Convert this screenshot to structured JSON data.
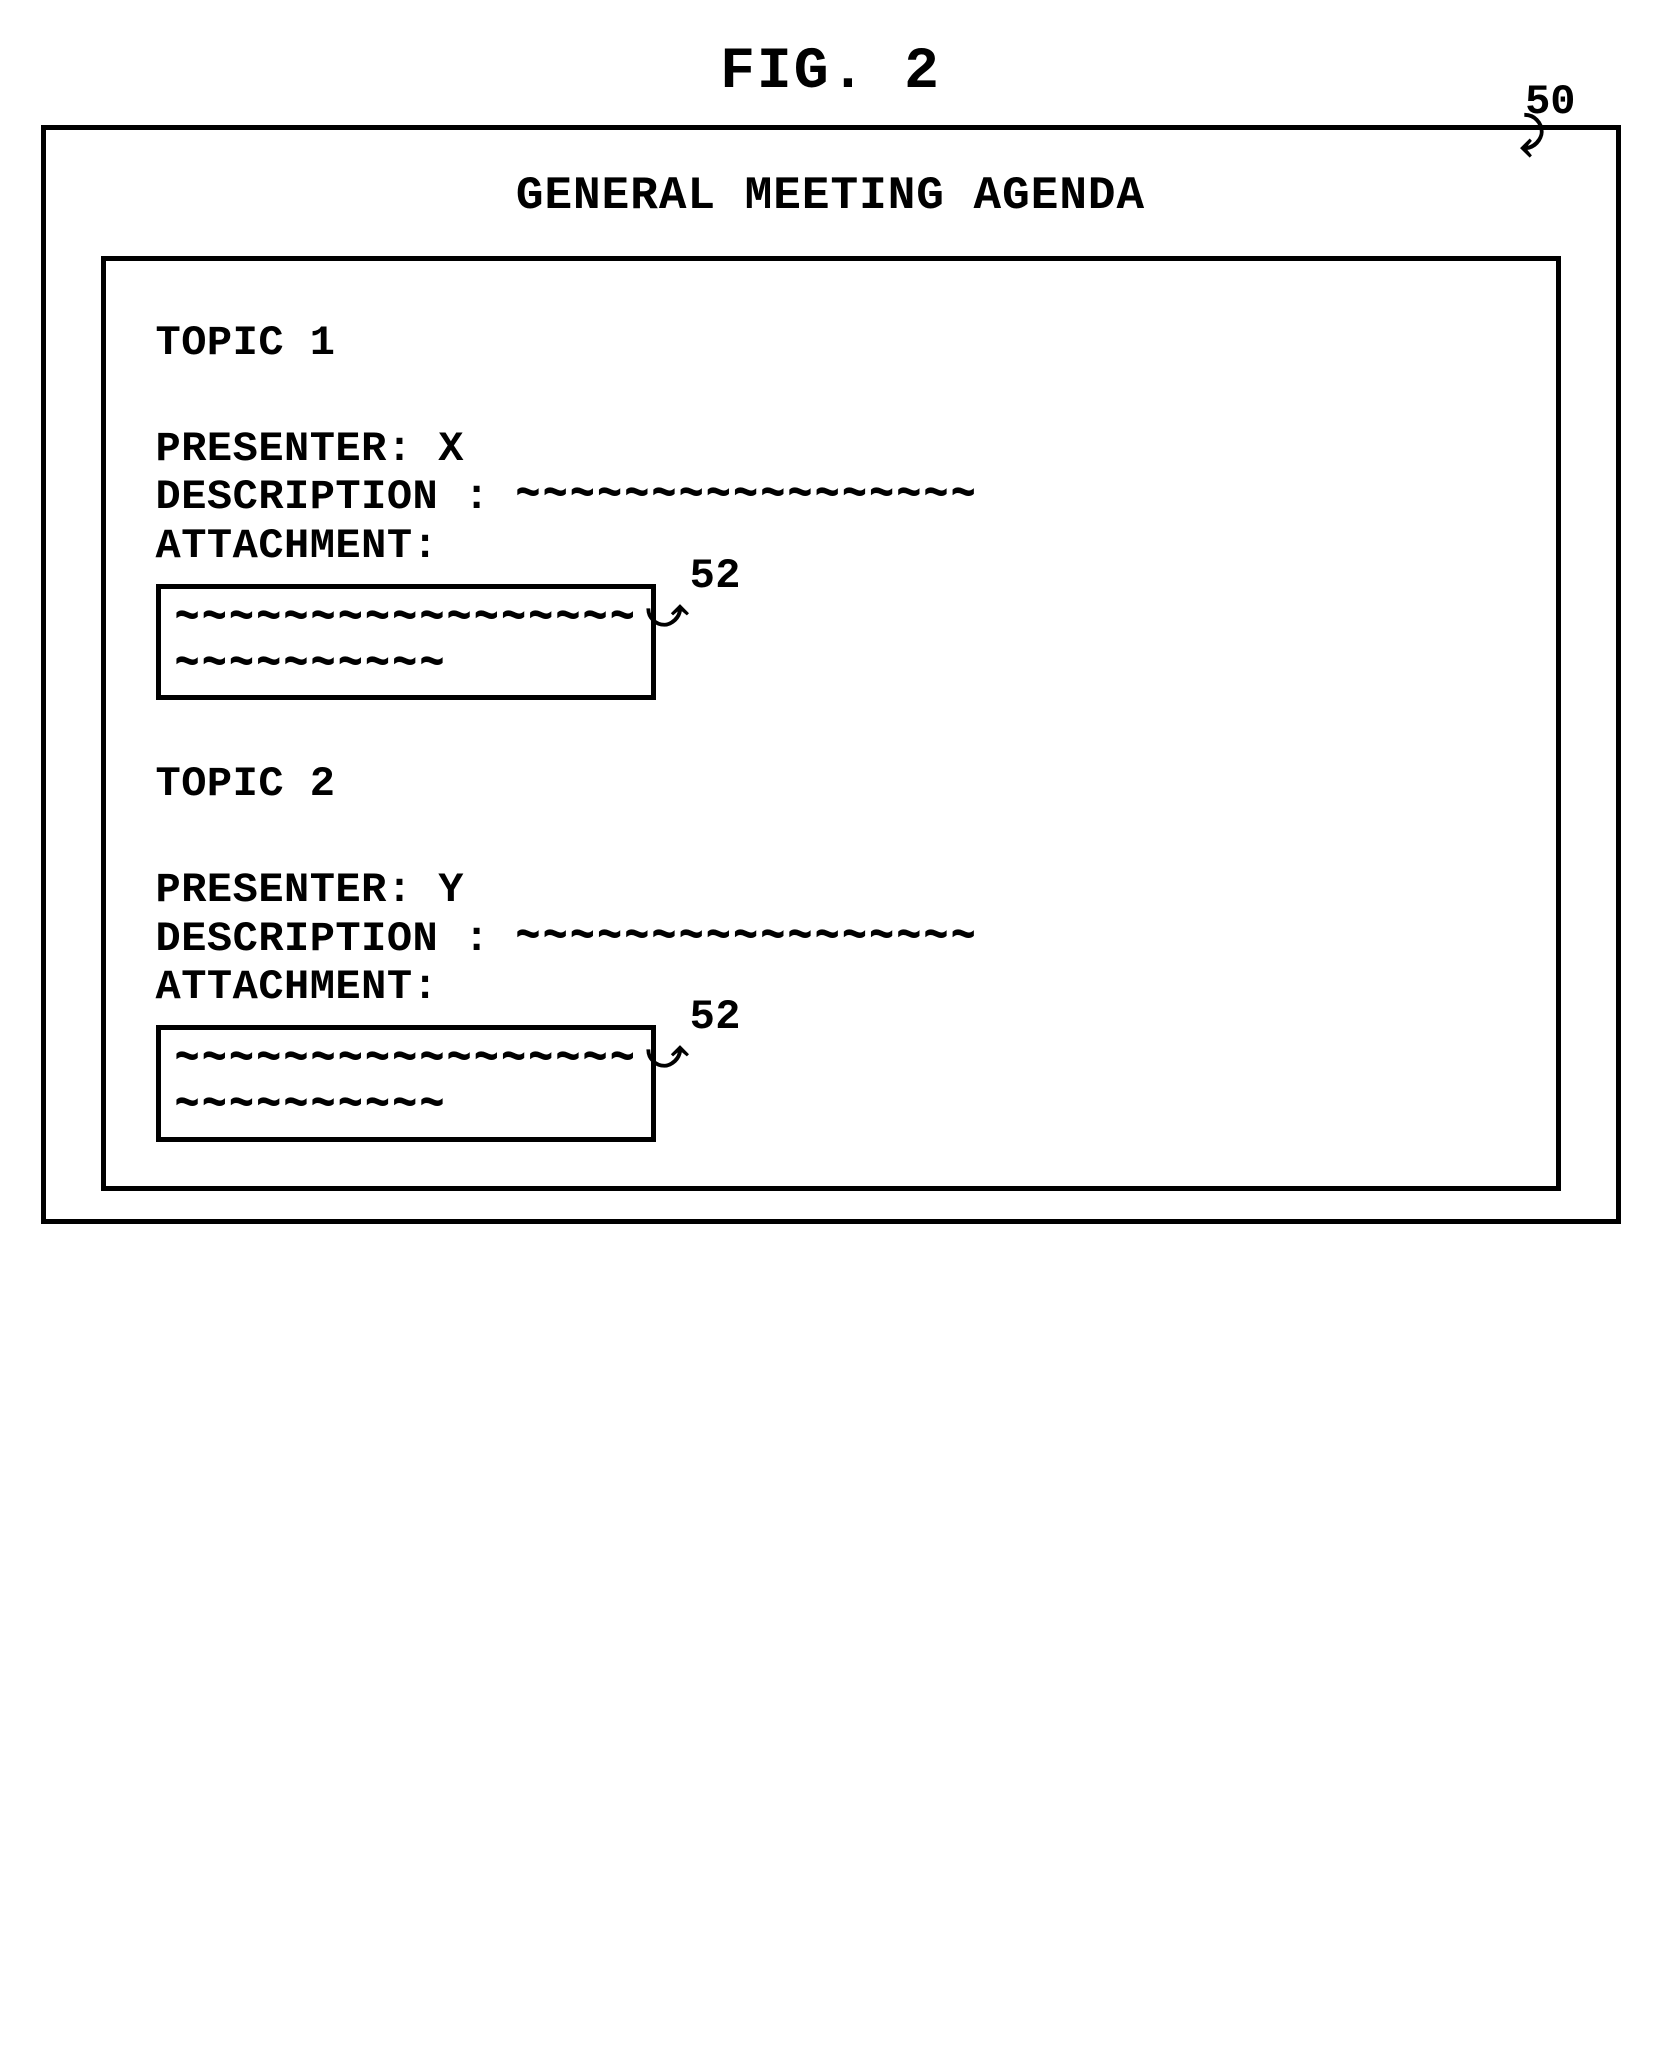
{
  "figure_label": "FIG. 2",
  "outer_ref": "50",
  "title": "GENERAL MEETING AGENDA",
  "attach_ref": "52",
  "wave_long": "~~~~~~~~~~~~~~~~~",
  "wave_short": "~~~~~~~~~~",
  "topics": [
    {
      "heading": "TOPIC 1",
      "presenter_label": "PRESENTER:",
      "presenter_value": "X",
      "description_label": "DESCRIPTION :",
      "attachment_label": "ATTACHMENT:"
    },
    {
      "heading": "TOPIC 2",
      "presenter_label": "PRESENTER:",
      "presenter_value": "Y",
      "description_label": "DESCRIPTION :",
      "attachment_label": "ATTACHMENT:"
    }
  ]
}
